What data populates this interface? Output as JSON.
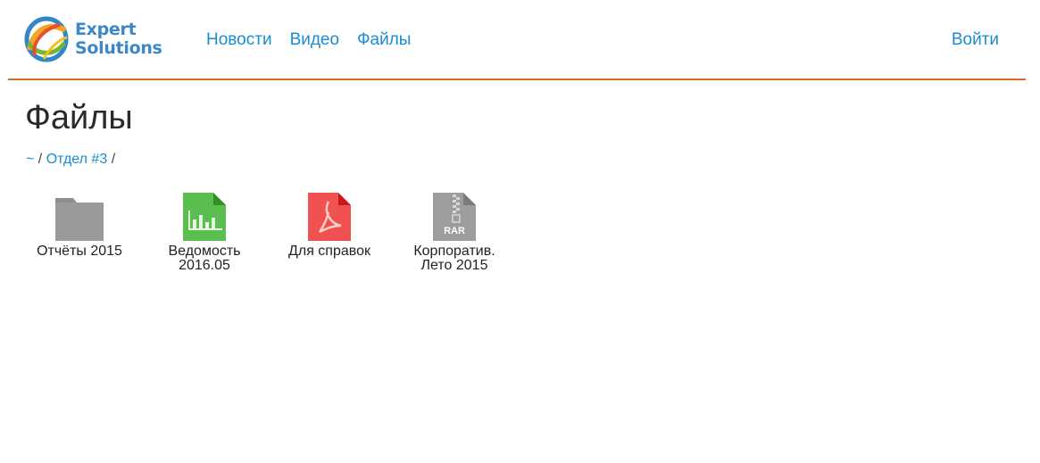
{
  "header": {
    "logo": {
      "line1": "Expert",
      "line2": "Solutions"
    },
    "nav": [
      {
        "label": "Новости"
      },
      {
        "label": "Видео"
      },
      {
        "label": "Файлы"
      }
    ],
    "login_label": "Войти",
    "accent_color": "#d9692a",
    "link_color": "#1a8ccf"
  },
  "page": {
    "title": "Файлы",
    "breadcrumb": {
      "root": "~",
      "sep1": "/",
      "folder": "Отдел #3",
      "sep2": "/"
    }
  },
  "files": [
    {
      "label": "Отчёты 2015",
      "icon": "folder-icon"
    },
    {
      "label": "Ведомость 2016.05",
      "icon": "spreadsheet-icon"
    },
    {
      "label": "Для справок",
      "icon": "pdf-icon"
    },
    {
      "label": "Корпоратив. Лето 2015",
      "icon": "rar-archive-icon",
      "badge": "RAR"
    }
  ]
}
